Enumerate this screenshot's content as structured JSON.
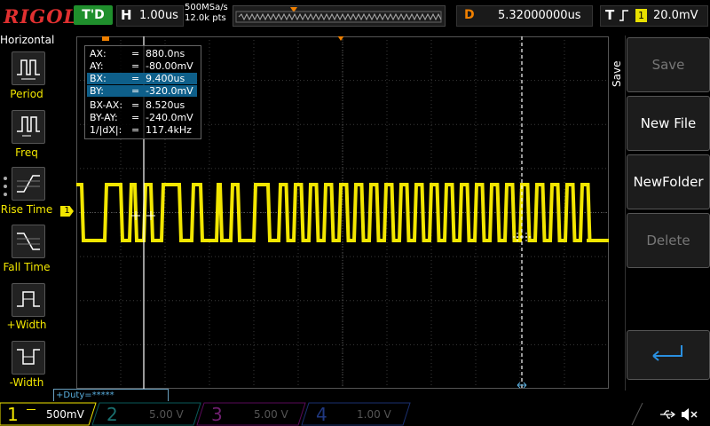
{
  "top": {
    "brand": "RIGOL",
    "run_state": "T'D",
    "horizontal_label": "H",
    "timebase": "1.00us",
    "sample_rate": "500MSa/s",
    "memory_depth": "12.0k pts",
    "delay_label": "D",
    "delay": "5.32000000us",
    "trigger_label": "T",
    "trigger_channel": "1",
    "trigger_level": "20.0mV"
  },
  "left": {
    "title": "Horizontal",
    "items": [
      {
        "label": "Period"
      },
      {
        "label": "Freq"
      },
      {
        "label": "Rise Time"
      },
      {
        "label": "Fall Time"
      },
      {
        "label": "+Width"
      },
      {
        "label": "-Width"
      }
    ]
  },
  "cursor": {
    "rows": [
      {
        "key": "AX:",
        "value": "880.0ns"
      },
      {
        "key": "AY:",
        "value": "-80.00mV"
      },
      {
        "key": "BX:",
        "value": "9.400us"
      },
      {
        "key": "BY:",
        "value": "-320.0mV"
      },
      {
        "key": "BX-AX:",
        "value": "8.520us"
      },
      {
        "key": "BY-AY:",
        "value": "-240.0mV"
      },
      {
        "key": "1/|dX|:",
        "value": "117.4kHz"
      }
    ],
    "eq": "="
  },
  "right": {
    "title": "Save",
    "buttons": [
      {
        "label": "Save",
        "enabled": false
      },
      {
        "label": "New File",
        "enabled": true
      },
      {
        "label": "NewFolder",
        "enabled": true
      },
      {
        "label": "Delete",
        "enabled": false
      }
    ]
  },
  "measure": {
    "duty": "+Duty=*****"
  },
  "channels": [
    {
      "num": "1",
      "scale": "500mV",
      "color": "#f2e600",
      "active": true
    },
    {
      "num": "2",
      "scale": "5.00 V",
      "color": "#00c8c8",
      "active": false
    },
    {
      "num": "3",
      "scale": "5.00 V",
      "color": "#e000e0",
      "active": false
    },
    {
      "num": "4",
      "scale": "1.00 V",
      "color": "#2060ff",
      "active": false
    }
  ],
  "markers": {
    "ch1": "1",
    "trig": "T"
  },
  "icons": [
    "usb-icon",
    "speaker-muted-icon",
    "enter-icon"
  ]
}
